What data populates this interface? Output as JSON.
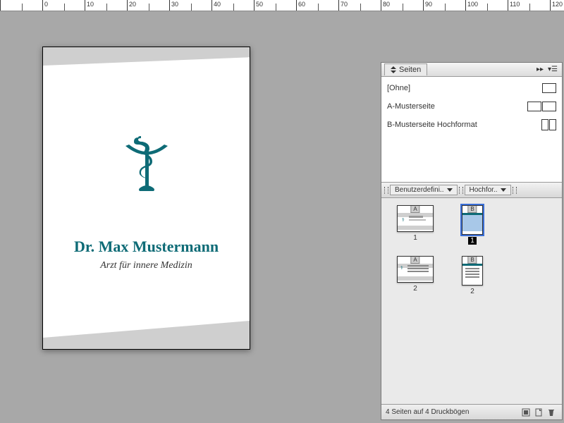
{
  "ruler": {
    "ticks": [
      0,
      0,
      10,
      20,
      30,
      40,
      50,
      60,
      70,
      80,
      90,
      100,
      110,
      120
    ]
  },
  "document": {
    "title": "Dr. Max Mustermann",
    "subtitle": "Arzt für innere Medizin"
  },
  "panel": {
    "title": "Seiten",
    "masters": [
      {
        "label": "[Ohne]",
        "icon": "single"
      },
      {
        "label": "A-Musterseite",
        "icon": "spread-land"
      },
      {
        "label": "B-Musterseite Hochformat",
        "icon": "spread-port"
      }
    ],
    "sections": [
      {
        "label": "Benutzerdefini.."
      },
      {
        "label": "Hochfor.."
      }
    ],
    "pages": [
      {
        "n": "1",
        "master": "A",
        "orient": "landscape",
        "selected": false,
        "inv": false
      },
      {
        "n": "1",
        "master": "B",
        "orient": "portrait",
        "selected": true,
        "inv": true
      },
      {
        "n": "2",
        "master": "A",
        "orient": "landscape",
        "selected": false,
        "inv": false
      },
      {
        "n": "2",
        "master": "B",
        "orient": "portrait",
        "selected": false,
        "inv": false
      }
    ],
    "status": "4 Seiten auf 4 Druckbögen"
  }
}
